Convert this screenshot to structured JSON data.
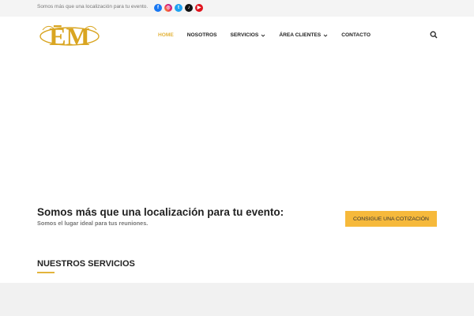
{
  "topbar": {
    "tagline": "Somos más que una localización para tu evento.",
    "socials": [
      {
        "name": "facebook-icon",
        "glyph": "f"
      },
      {
        "name": "instagram-icon",
        "glyph": "◎"
      },
      {
        "name": "twitter-icon",
        "glyph": "t"
      },
      {
        "name": "tiktok-icon",
        "glyph": "♪"
      },
      {
        "name": "youtube-icon",
        "glyph": "▶"
      }
    ]
  },
  "header": {
    "logo_icon": "em-monogram-logo",
    "nav": [
      {
        "label": "HOME",
        "active": true,
        "dropdown": false
      },
      {
        "label": "NOSOTROS",
        "active": false,
        "dropdown": false
      },
      {
        "label": "SERVICIOS",
        "active": false,
        "dropdown": true
      },
      {
        "label": "ÁREA CLIENTES",
        "active": false,
        "dropdown": true
      },
      {
        "label": "CONTACTO",
        "active": false,
        "dropdown": false
      }
    ],
    "search_icon": "search-icon"
  },
  "cta": {
    "title": "Somos más que una localización para tu evento:",
    "subtitle": "Somos el lugar ideal para tus reuniones.",
    "button_label": "CONSIGUE UNA COTIZACIÓN"
  },
  "services": {
    "title": "NUESTROS SERVICIOS"
  },
  "colors": {
    "accent": "#e3b43c",
    "button": "#f6b93b",
    "topbar_bg": "#f4f4f4"
  }
}
